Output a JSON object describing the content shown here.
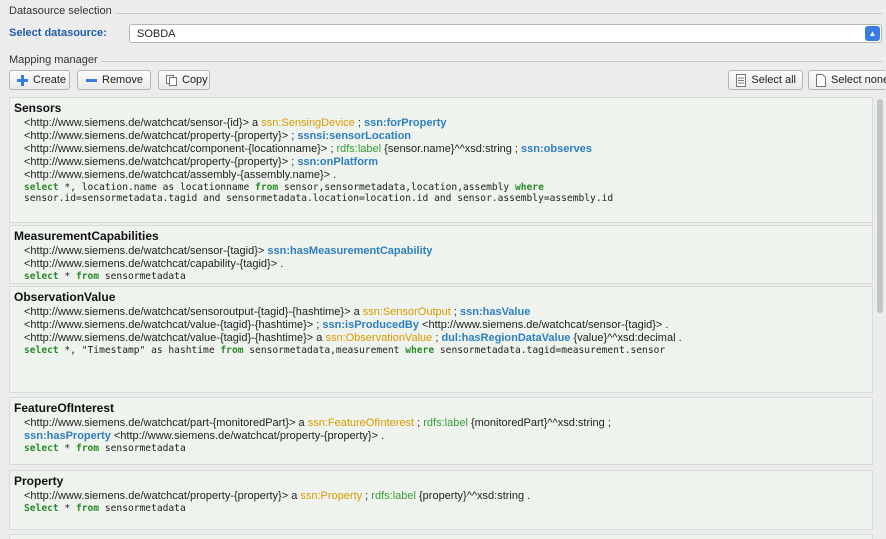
{
  "datasource": {
    "group_title": "Datasource selection",
    "select_label": "Select datasource:",
    "selected_value": "SOBDA"
  },
  "mapping": {
    "group_title": "Mapping manager",
    "create_label": "Create",
    "remove_label": "Remove",
    "copy_label": "Copy",
    "select_all_label": "Select all",
    "select_none_label": "Select none"
  },
  "cards": [
    {
      "title": "Sensors",
      "lines": [
        [
          [
            "t",
            "<http://www.siemens.de/watchcat/sensor-{id}> a "
          ],
          [
            "o",
            "ssn:SensingDevice"
          ],
          [
            "t",
            " ; "
          ],
          [
            "b",
            "ssn:forProperty"
          ]
        ],
        [
          [
            "t",
            "<http://www.siemens.de/watchcat/property-{property}> ; "
          ],
          [
            "b",
            "ssnsi:sensorLocation"
          ]
        ],
        [
          [
            "t",
            "<http://www.siemens.de/watchcat/component-{locationname}> ; "
          ],
          [
            "g",
            "rdfs:label"
          ],
          [
            "t",
            " {sensor.name}^^xsd:string ; "
          ],
          [
            "b",
            "ssn:observes"
          ]
        ],
        [
          [
            "t",
            "<http://www.siemens.de/watchcat/property-{property}> ; "
          ],
          [
            "b",
            "ssn:onPlatform"
          ]
        ],
        [
          [
            "t",
            "<http://www.siemens.de/watchcat/assembly-{assembly.name}> ."
          ]
        ]
      ],
      "sql": [
        [
          [
            "k",
            "select"
          ],
          [
            "t",
            " *, location.name as locationname "
          ],
          [
            "k",
            "from"
          ],
          [
            "t",
            " sensor,sensormetadata,location,assembly "
          ],
          [
            "k",
            "where"
          ]
        ],
        [
          [
            "t",
            "sensor.id=sensormetadata.tagid and sensormetadata.location=location.id and sensor.assembly=assembly.id"
          ]
        ]
      ]
    },
    {
      "title": "MeasurementCapabilities",
      "lines": [
        [
          [
            "t",
            "<http://www.siemens.de/watchcat/sensor-{tagid}> "
          ],
          [
            "b",
            "ssn:hasMeasurementCapability"
          ]
        ],
        [
          [
            "t",
            "<http://www.siemens.de/watchcat/capability-{tagid}> ."
          ]
        ]
      ],
      "sql": [
        [
          [
            "k",
            "select"
          ],
          [
            "t",
            " * "
          ],
          [
            "k",
            "from"
          ],
          [
            "t",
            " sensormetadata"
          ]
        ]
      ]
    },
    {
      "title": "ObservationValue",
      "lines": [
        [
          [
            "t",
            "<http://www.siemens.de/watchcat/sensoroutput-{tagid}-{hashtime}> a "
          ],
          [
            "o",
            "ssn:SensorOutput"
          ],
          [
            "t",
            " ; "
          ],
          [
            "b",
            "ssn:hasValue"
          ]
        ],
        [
          [
            "t",
            "<http://www.siemens.de/watchcat/value-{tagid}-{hashtime}> ; "
          ],
          [
            "b",
            "ssn:isProducedBy"
          ],
          [
            "t",
            " <http://www.siemens.de/watchcat/sensor-{tagid}> ."
          ]
        ],
        [
          [
            "t",
            "<http://www.siemens.de/watchcat/value-{tagid}-{hashtime}> a "
          ],
          [
            "o",
            "ssn:ObservationValue"
          ],
          [
            "t",
            " ; "
          ],
          [
            "b",
            "dul:hasRegionDataValue"
          ],
          [
            "t",
            " {value}^^xsd:decimal ."
          ]
        ]
      ],
      "sql": [
        [
          [
            "k",
            "select"
          ],
          [
            "t",
            " *, \"Timestamp\" as hashtime "
          ],
          [
            "k",
            "from"
          ],
          [
            "t",
            " sensormetadata,measurement "
          ],
          [
            "k",
            "where"
          ],
          [
            "t",
            " sensormetadata.tagid=measurement.sensor"
          ]
        ]
      ]
    },
    {
      "title": "FeatureOfInterest",
      "lines": [
        [
          [
            "t",
            "<http://www.siemens.de/watchcat/part-{monitoredPart}> a "
          ],
          [
            "o",
            "ssn:FeatureOfInterest"
          ],
          [
            "t",
            " ; "
          ],
          [
            "g",
            "rdfs:label"
          ],
          [
            "t",
            " {monitoredPart}^^xsd:string ;"
          ]
        ],
        [
          [
            "b",
            "ssn:hasProperty"
          ],
          [
            "t",
            " <http://www.siemens.de/watchcat/property-{property}> ."
          ]
        ]
      ],
      "sql": [
        [
          [
            "k",
            "select"
          ],
          [
            "t",
            " * "
          ],
          [
            "k",
            "from"
          ],
          [
            "t",
            " sensormetadata"
          ]
        ]
      ]
    },
    {
      "title": "Property",
      "lines": [
        [
          [
            "t",
            "<http://www.siemens.de/watchcat/property-{property}> a "
          ],
          [
            "o",
            "ssn:Property"
          ],
          [
            "t",
            " ; "
          ],
          [
            "g",
            "rdfs:label"
          ],
          [
            "t",
            " {property}^^xsd:string ."
          ]
        ]
      ],
      "sql": [
        [
          [
            "k",
            "Select"
          ],
          [
            "t",
            " * "
          ],
          [
            "k",
            "from"
          ],
          [
            "t",
            " sensormetadata"
          ]
        ]
      ]
    }
  ],
  "colors": {
    "accent": "#2f7fc0",
    "class": "#d89a00",
    "label": "#3a9b3a",
    "keyword": "#2b8a2b",
    "card_bg": "#eef3ee"
  },
  "icons": {
    "create": "plus-icon",
    "remove": "minus-icon",
    "copy": "copy-icon",
    "select_all": "document-icon",
    "select_none": "blank-document-icon",
    "dropdown": "chevron-updown-icon"
  }
}
